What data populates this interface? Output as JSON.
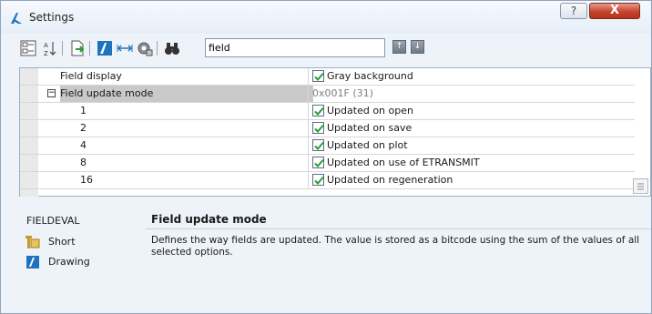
{
  "window": {
    "title": "Settings",
    "help_label": "?",
    "close_label": "X"
  },
  "toolbar": {
    "search_value": "field",
    "prev_label": "↑",
    "next_label": "↓",
    "icons": [
      "categorized-view-icon",
      "alphabetic-view-icon",
      "export-icon",
      "drawing-scope-icon",
      "expand-width-icon",
      "settings-gear-icon",
      "find-binoculars-icon"
    ]
  },
  "grid": {
    "rows": [
      {
        "name": "Field display",
        "value": "Gray background",
        "checkbox": true,
        "checked": true
      },
      {
        "name": "Field update mode",
        "value": "0x001F (31)",
        "checkbox": false,
        "expander": "−"
      },
      {
        "name": "1",
        "value": "Updated on open",
        "checkbox": true,
        "checked": true
      },
      {
        "name": "2",
        "value": "Updated on save",
        "checkbox": true,
        "checked": true
      },
      {
        "name": "4",
        "value": "Updated on plot",
        "checkbox": true,
        "checked": true
      },
      {
        "name": "8",
        "value": "Updated on use of ETRANSMIT",
        "checkbox": true,
        "checked": true
      },
      {
        "name": "16",
        "value": "Updated on regeneration",
        "checkbox": true,
        "checked": true
      }
    ]
  },
  "details": {
    "system_variable": "FIELDEVAL",
    "type_label": "Short",
    "scope_label": "Drawing",
    "title": "Field update mode",
    "description": "Defines the way fields are updated. The value is stored as a bitcode using the sum of the values of all selected options."
  },
  "colors": {
    "accent": "#1e73be",
    "selected_row": "#c9c9c9",
    "window_bg": "#eef3f9"
  }
}
